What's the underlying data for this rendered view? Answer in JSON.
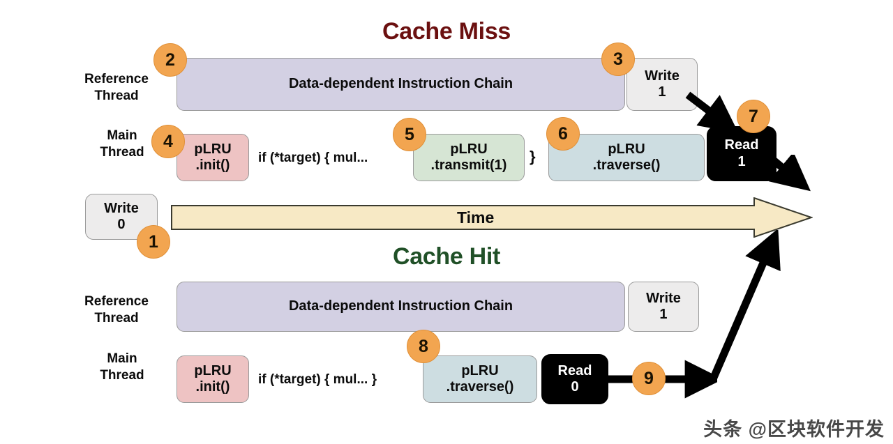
{
  "figure": {
    "sections": [
      {
        "id": "cache-miss",
        "title": "Cache Miss",
        "title_color": "#6b1010"
      },
      {
        "id": "cache-hit",
        "title": "Cache Hit",
        "title_color": "#205027"
      }
    ],
    "labels": {
      "reference_thread": "Reference\nThread",
      "main_thread": "Main\nThread",
      "time": "Time"
    },
    "miss": {
      "chain": "Data-dependent Instruction Chain",
      "write1": "Write\n1",
      "plru_init": "pLRU\n.init()",
      "code": "if (*target) { mul...",
      "brace": "}",
      "plru_transmit": "pLRU\n.transmit(1)",
      "plru_traverse": "pLRU\n.traverse()",
      "read1": "Read\n1"
    },
    "hit": {
      "chain": "Data-dependent Instruction Chain",
      "write1": "Write\n1",
      "plru_init": "pLRU\n.init()",
      "code": "if (*target) { mul... }",
      "plru_traverse": "pLRU\n.traverse()",
      "read0": "Read\n0"
    },
    "timeline": {
      "write0": "Write\n0"
    },
    "steps": [
      {
        "n": "1",
        "target": "write-0-box"
      },
      {
        "n": "2",
        "target": "miss-reference-chain"
      },
      {
        "n": "3",
        "target": "miss-write-1"
      },
      {
        "n": "4",
        "target": "miss-plru-init"
      },
      {
        "n": "5",
        "target": "miss-plru-transmit"
      },
      {
        "n": "6",
        "target": "miss-plru-traverse"
      },
      {
        "n": "7",
        "target": "miss-read-1"
      },
      {
        "n": "8",
        "target": "hit-plru-traverse"
      },
      {
        "n": "9",
        "target": "hit-read-0-arrow"
      }
    ],
    "colors": {
      "badge": "#f2a550",
      "chain_block": "#d3d0e3",
      "write_block": "#edecec",
      "plru_init_block": "#eec3c3",
      "plru_transmit_block": "#d6e5d4",
      "plru_traverse_block": "#cddde1",
      "read_block": "#000000",
      "time_arrow": "#f7e9c5",
      "background": "#ffffff"
    },
    "watermark": "头条 @区块软件开发"
  }
}
